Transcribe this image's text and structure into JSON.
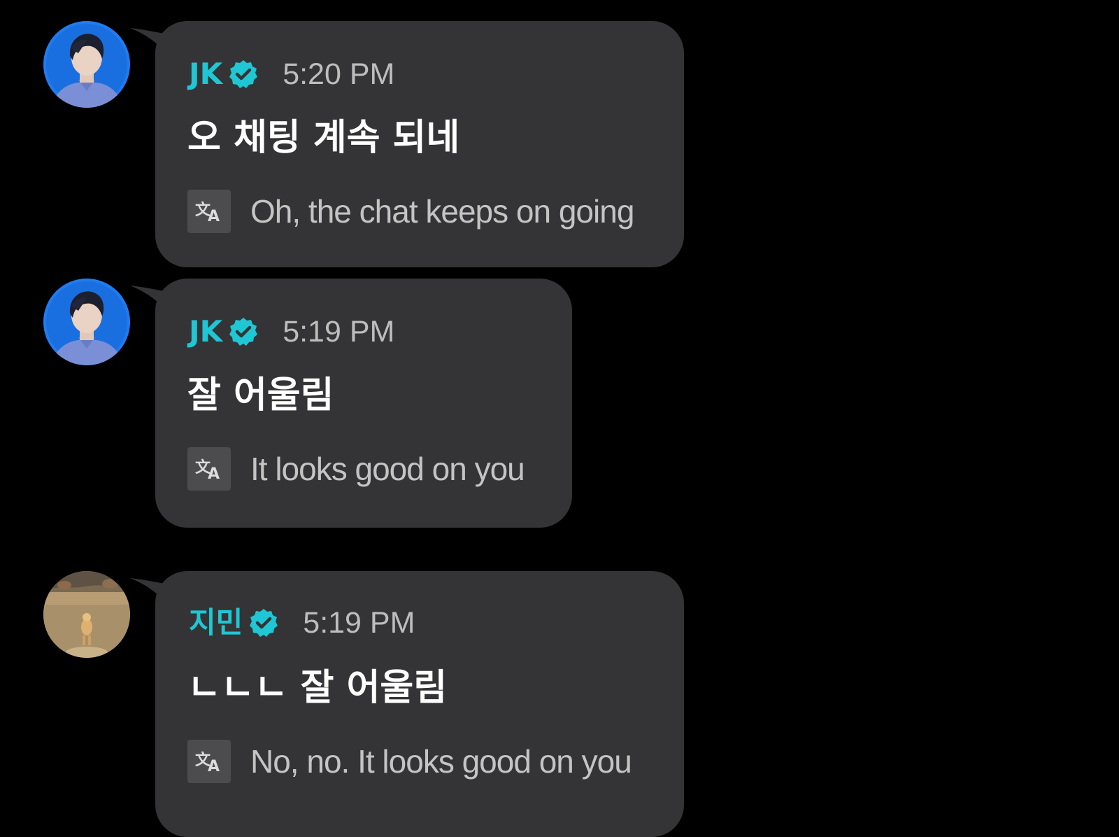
{
  "colors": {
    "background": "#000000",
    "bubble": "#343436",
    "name_accent": "#1fc7d4",
    "verified_badge": "#1fc7d4",
    "time_text": "#bdbdbd",
    "message_text": "#ffffff",
    "translation_text": "#c4c4c4"
  },
  "messages": [
    {
      "sender": "JK",
      "verified_icon": "verified-badge-icon",
      "time": "5:20 PM",
      "text": "오 채팅 계속 되네",
      "translate_icon": "translate-icon",
      "translation": "Oh, the chat keeps on going",
      "avatar": "avatar-jk"
    },
    {
      "sender": "JK",
      "verified_icon": "verified-badge-icon",
      "time": "5:19 PM",
      "text": "잘 어울림",
      "translate_icon": "translate-icon",
      "translation": "It looks good on you",
      "avatar": "avatar-jk"
    },
    {
      "sender": "지민",
      "verified_icon": "verified-badge-icon",
      "time": "5:19 PM",
      "text": "ㄴㄴㄴ 잘 어울림",
      "translate_icon": "translate-icon",
      "translation": "No, no. It looks good on you",
      "avatar": "avatar-jimin"
    }
  ]
}
